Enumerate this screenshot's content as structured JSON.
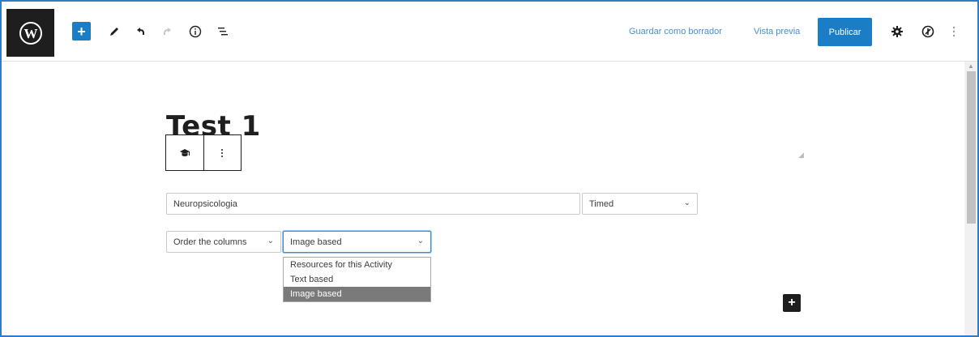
{
  "toolbar": {
    "add_symbol": "+",
    "save_draft_label": "Guardar como borrador",
    "preview_label": "Vista previa",
    "publish_label": "Publicar"
  },
  "icons": {
    "logo": "wordpress-logo",
    "tools": "pencil-icon",
    "undo": "undo-icon",
    "redo": "redo-icon",
    "details": "info-icon",
    "outline": "list-view-icon",
    "settings": "gear-icon",
    "plugin": "plugin-icon",
    "more": "more-vertical-icon",
    "block_type": "mortarboard-icon",
    "block_options": "kebab-icon"
  },
  "colors": {
    "accent": "#1a7dc6",
    "dark": "#1e1e1e",
    "frame": "#2f7cc4"
  },
  "editor": {
    "post_title": "Test 1"
  },
  "activity": {
    "name_value": "Neuropsicologia",
    "mode_value": "Timed",
    "column_type_value": "Order the columns",
    "content_type_value": "Image based",
    "content_type_options": [
      "Resources for this Activity",
      "Text based",
      "Image based"
    ]
  },
  "inserter": {
    "symbol": "+"
  }
}
